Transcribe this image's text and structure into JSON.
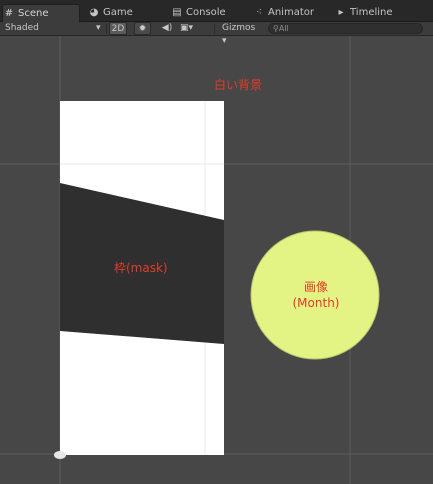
{
  "tabs": [
    {
      "label": "Scene",
      "icon": "grid-icon",
      "active": true
    },
    {
      "label": "Game",
      "icon": "pacman-icon",
      "active": false
    },
    {
      "label": "Console",
      "icon": "console-icon",
      "active": false
    },
    {
      "label": "Animator",
      "icon": "animator-icon",
      "active": false
    },
    {
      "label": "Timeline",
      "icon": "timeline-icon",
      "active": false
    }
  ],
  "toolbar": {
    "shading_mode": "Shaded",
    "mode_2d": "2D",
    "gizmos": "Gizmos",
    "search_placeholder": "All"
  },
  "scene": {
    "background_label": "白い背景",
    "frame_label": "枠(mask)",
    "image_label_line1": "画像",
    "image_label_line2": "(Month)"
  },
  "colors": {
    "scene_background": "#474747",
    "white_background": "#ffffff",
    "frame_mask": "#2f2f2f",
    "circle_fill": "#e4f484",
    "label_red": "#e23b2a"
  }
}
